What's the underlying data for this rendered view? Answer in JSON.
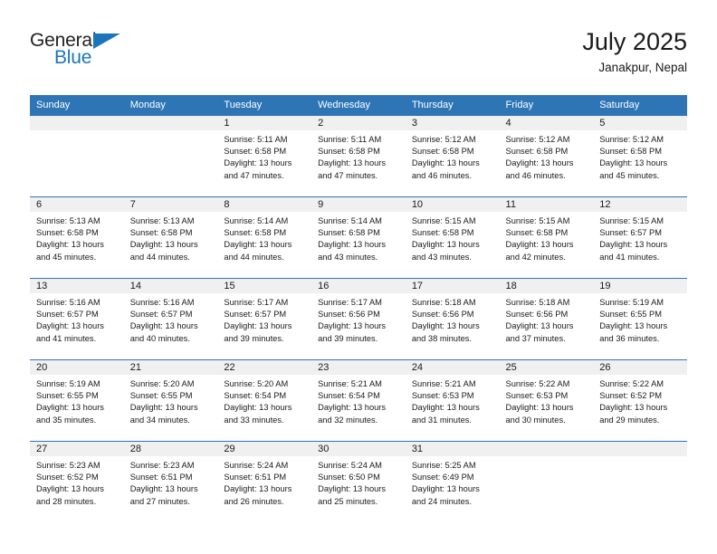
{
  "branding": {
    "logo_primary": "General",
    "logo_secondary": "Blue",
    "logo_accent_color": "#1b75bb"
  },
  "header": {
    "title": "July 2025",
    "subtitle": "Janakpur, Nepal"
  },
  "theme": {
    "header_blue": "#2e75b6",
    "band_gray": "#f0f0f0",
    "text_color": "#1a1a1a"
  },
  "weekday_headers": [
    "Sunday",
    "Monday",
    "Tuesday",
    "Wednesday",
    "Thursday",
    "Friday",
    "Saturday"
  ],
  "weeks": [
    [
      {
        "day": "",
        "sunrise": "",
        "sunset": "",
        "daylight_line1": "",
        "daylight_line2": ""
      },
      {
        "day": "",
        "sunrise": "",
        "sunset": "",
        "daylight_line1": "",
        "daylight_line2": ""
      },
      {
        "day": "1",
        "sunrise": "Sunrise: 5:11 AM",
        "sunset": "Sunset: 6:58 PM",
        "daylight_line1": "Daylight: 13 hours",
        "daylight_line2": "and 47 minutes."
      },
      {
        "day": "2",
        "sunrise": "Sunrise: 5:11 AM",
        "sunset": "Sunset: 6:58 PM",
        "daylight_line1": "Daylight: 13 hours",
        "daylight_line2": "and 47 minutes."
      },
      {
        "day": "3",
        "sunrise": "Sunrise: 5:12 AM",
        "sunset": "Sunset: 6:58 PM",
        "daylight_line1": "Daylight: 13 hours",
        "daylight_line2": "and 46 minutes."
      },
      {
        "day": "4",
        "sunrise": "Sunrise: 5:12 AM",
        "sunset": "Sunset: 6:58 PM",
        "daylight_line1": "Daylight: 13 hours",
        "daylight_line2": "and 46 minutes."
      },
      {
        "day": "5",
        "sunrise": "Sunrise: 5:12 AM",
        "sunset": "Sunset: 6:58 PM",
        "daylight_line1": "Daylight: 13 hours",
        "daylight_line2": "and 45 minutes."
      }
    ],
    [
      {
        "day": "6",
        "sunrise": "Sunrise: 5:13 AM",
        "sunset": "Sunset: 6:58 PM",
        "daylight_line1": "Daylight: 13 hours",
        "daylight_line2": "and 45 minutes."
      },
      {
        "day": "7",
        "sunrise": "Sunrise: 5:13 AM",
        "sunset": "Sunset: 6:58 PM",
        "daylight_line1": "Daylight: 13 hours",
        "daylight_line2": "and 44 minutes."
      },
      {
        "day": "8",
        "sunrise": "Sunrise: 5:14 AM",
        "sunset": "Sunset: 6:58 PM",
        "daylight_line1": "Daylight: 13 hours",
        "daylight_line2": "and 44 minutes."
      },
      {
        "day": "9",
        "sunrise": "Sunrise: 5:14 AM",
        "sunset": "Sunset: 6:58 PM",
        "daylight_line1": "Daylight: 13 hours",
        "daylight_line2": "and 43 minutes."
      },
      {
        "day": "10",
        "sunrise": "Sunrise: 5:15 AM",
        "sunset": "Sunset: 6:58 PM",
        "daylight_line1": "Daylight: 13 hours",
        "daylight_line2": "and 43 minutes."
      },
      {
        "day": "11",
        "sunrise": "Sunrise: 5:15 AM",
        "sunset": "Sunset: 6:58 PM",
        "daylight_line1": "Daylight: 13 hours",
        "daylight_line2": "and 42 minutes."
      },
      {
        "day": "12",
        "sunrise": "Sunrise: 5:15 AM",
        "sunset": "Sunset: 6:57 PM",
        "daylight_line1": "Daylight: 13 hours",
        "daylight_line2": "and 41 minutes."
      }
    ],
    [
      {
        "day": "13",
        "sunrise": "Sunrise: 5:16 AM",
        "sunset": "Sunset: 6:57 PM",
        "daylight_line1": "Daylight: 13 hours",
        "daylight_line2": "and 41 minutes."
      },
      {
        "day": "14",
        "sunrise": "Sunrise: 5:16 AM",
        "sunset": "Sunset: 6:57 PM",
        "daylight_line1": "Daylight: 13 hours",
        "daylight_line2": "and 40 minutes."
      },
      {
        "day": "15",
        "sunrise": "Sunrise: 5:17 AM",
        "sunset": "Sunset: 6:57 PM",
        "daylight_line1": "Daylight: 13 hours",
        "daylight_line2": "and 39 minutes."
      },
      {
        "day": "16",
        "sunrise": "Sunrise: 5:17 AM",
        "sunset": "Sunset: 6:56 PM",
        "daylight_line1": "Daylight: 13 hours",
        "daylight_line2": "and 39 minutes."
      },
      {
        "day": "17",
        "sunrise": "Sunrise: 5:18 AM",
        "sunset": "Sunset: 6:56 PM",
        "daylight_line1": "Daylight: 13 hours",
        "daylight_line2": "and 38 minutes."
      },
      {
        "day": "18",
        "sunrise": "Sunrise: 5:18 AM",
        "sunset": "Sunset: 6:56 PM",
        "daylight_line1": "Daylight: 13 hours",
        "daylight_line2": "and 37 minutes."
      },
      {
        "day": "19",
        "sunrise": "Sunrise: 5:19 AM",
        "sunset": "Sunset: 6:55 PM",
        "daylight_line1": "Daylight: 13 hours",
        "daylight_line2": "and 36 minutes."
      }
    ],
    [
      {
        "day": "20",
        "sunrise": "Sunrise: 5:19 AM",
        "sunset": "Sunset: 6:55 PM",
        "daylight_line1": "Daylight: 13 hours",
        "daylight_line2": "and 35 minutes."
      },
      {
        "day": "21",
        "sunrise": "Sunrise: 5:20 AM",
        "sunset": "Sunset: 6:55 PM",
        "daylight_line1": "Daylight: 13 hours",
        "daylight_line2": "and 34 minutes."
      },
      {
        "day": "22",
        "sunrise": "Sunrise: 5:20 AM",
        "sunset": "Sunset: 6:54 PM",
        "daylight_line1": "Daylight: 13 hours",
        "daylight_line2": "and 33 minutes."
      },
      {
        "day": "23",
        "sunrise": "Sunrise: 5:21 AM",
        "sunset": "Sunset: 6:54 PM",
        "daylight_line1": "Daylight: 13 hours",
        "daylight_line2": "and 32 minutes."
      },
      {
        "day": "24",
        "sunrise": "Sunrise: 5:21 AM",
        "sunset": "Sunset: 6:53 PM",
        "daylight_line1": "Daylight: 13 hours",
        "daylight_line2": "and 31 minutes."
      },
      {
        "day": "25",
        "sunrise": "Sunrise: 5:22 AM",
        "sunset": "Sunset: 6:53 PM",
        "daylight_line1": "Daylight: 13 hours",
        "daylight_line2": "and 30 minutes."
      },
      {
        "day": "26",
        "sunrise": "Sunrise: 5:22 AM",
        "sunset": "Sunset: 6:52 PM",
        "daylight_line1": "Daylight: 13 hours",
        "daylight_line2": "and 29 minutes."
      }
    ],
    [
      {
        "day": "27",
        "sunrise": "Sunrise: 5:23 AM",
        "sunset": "Sunset: 6:52 PM",
        "daylight_line1": "Daylight: 13 hours",
        "daylight_line2": "and 28 minutes."
      },
      {
        "day": "28",
        "sunrise": "Sunrise: 5:23 AM",
        "sunset": "Sunset: 6:51 PM",
        "daylight_line1": "Daylight: 13 hours",
        "daylight_line2": "and 27 minutes."
      },
      {
        "day": "29",
        "sunrise": "Sunrise: 5:24 AM",
        "sunset": "Sunset: 6:51 PM",
        "daylight_line1": "Daylight: 13 hours",
        "daylight_line2": "and 26 minutes."
      },
      {
        "day": "30",
        "sunrise": "Sunrise: 5:24 AM",
        "sunset": "Sunset: 6:50 PM",
        "daylight_line1": "Daylight: 13 hours",
        "daylight_line2": "and 25 minutes."
      },
      {
        "day": "31",
        "sunrise": "Sunrise: 5:25 AM",
        "sunset": "Sunset: 6:49 PM",
        "daylight_line1": "Daylight: 13 hours",
        "daylight_line2": "and 24 minutes."
      },
      {
        "day": "",
        "sunrise": "",
        "sunset": "",
        "daylight_line1": "",
        "daylight_line2": ""
      },
      {
        "day": "",
        "sunrise": "",
        "sunset": "",
        "daylight_line1": "",
        "daylight_line2": ""
      }
    ]
  ]
}
